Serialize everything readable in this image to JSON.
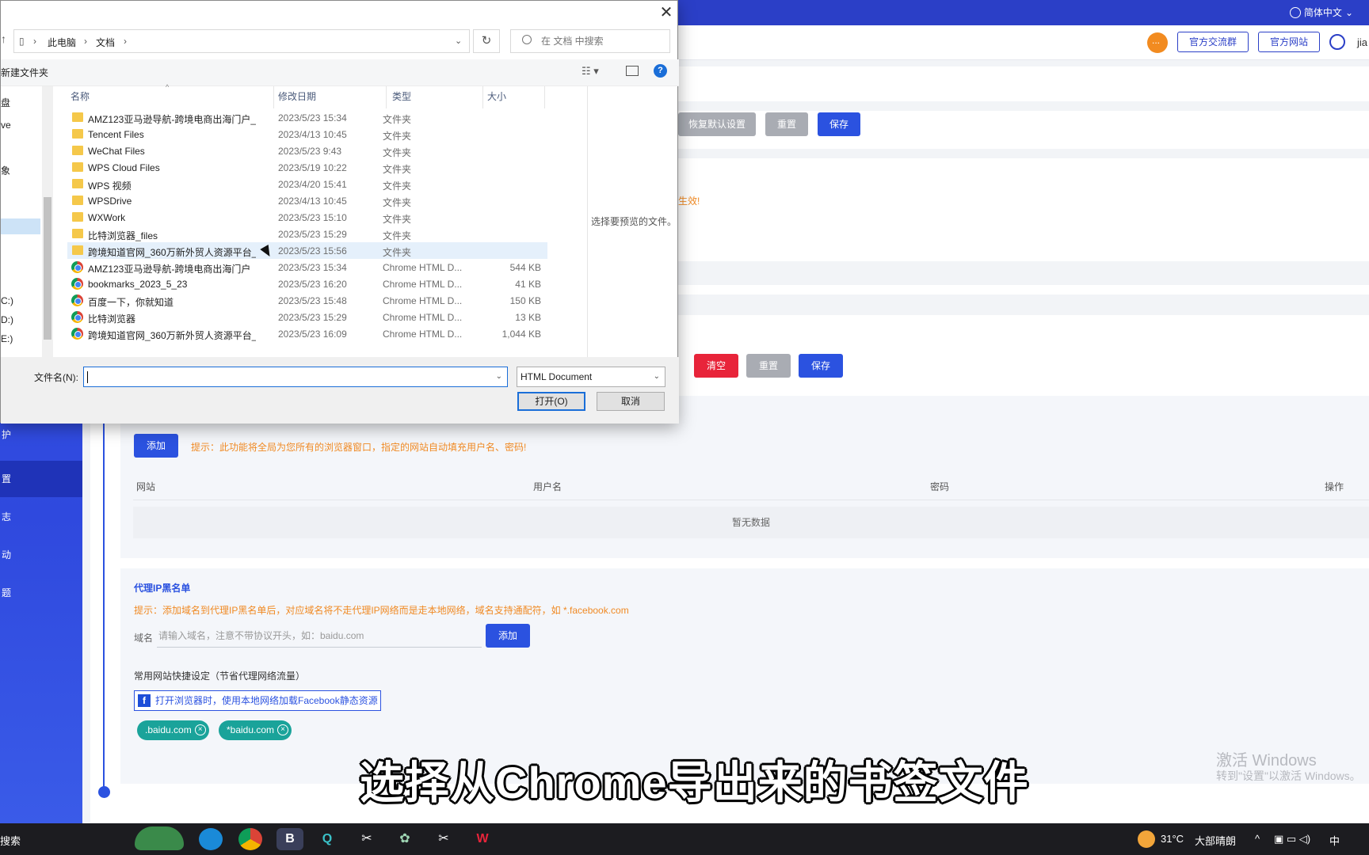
{
  "app": {
    "language": "简体中文",
    "header_buttons": [
      "官方交流群",
      "官方网站"
    ],
    "user": "jia"
  },
  "sidebar": {
    "items": [
      "置",
      "志",
      "动",
      "题",
      "护"
    ]
  },
  "toolbar1": {
    "restore": "恢复默认设置",
    "reset": "重置",
    "save": "保存"
  },
  "notice1": "生效!",
  "toolbar2": {
    "clear": "清空",
    "reset": "重置",
    "save": "保存"
  },
  "autofill": {
    "add": "添加",
    "tip": "提示：此功能将全局为您所有的浏览器窗口，指定的网站自动填充用户名、密码!",
    "columns": [
      "网站",
      "用户名",
      "密码",
      "操作"
    ],
    "empty": "暂无数据"
  },
  "blacklist": {
    "title": "代理IP黑名单",
    "tip": "提示：添加域名到代理IP黑名单后，对应域名将不走代理IP网络而是走本地网络，域名支持通配符，如 *.facebook.com",
    "domain_label": "域名",
    "domain_placeholder": "请输入域名，注意不带协议开头，如：baidu.com",
    "add": "添加",
    "shortcut_title": "常用网站快捷设定（节省代理网络流量）",
    "facebook_option": "打开浏览器时，使用本地网络加载Facebook静态资源",
    "tags": [
      ".baidu.com",
      "*baidu.com"
    ]
  },
  "watermark": {
    "line1": "激活 Windows",
    "line2": "转到\"设置\"以激活 Windows。"
  },
  "subtitle": "选择从Chrome导出来的书签文件",
  "dialog": {
    "breadcrumb": [
      "此电脑",
      "文档"
    ],
    "search_placeholder": "在 文档 中搜索",
    "new_folder": "新建文件夹",
    "nav_items": [
      "盘",
      "ve",
      "象",
      "C:)",
      "D:)",
      "E:)"
    ],
    "columns": {
      "name": "名称",
      "date": "修改日期",
      "type": "类型",
      "size": "大小"
    },
    "files": [
      {
        "name": "AMZ123亚马逊导航-跨境电商出海门户_...",
        "date": "2023/5/23 15:34",
        "type": "文件夹",
        "size": "",
        "icon": "folder"
      },
      {
        "name": "Tencent Files",
        "date": "2023/4/13 10:45",
        "type": "文件夹",
        "size": "",
        "icon": "folder"
      },
      {
        "name": "WeChat Files",
        "date": "2023/5/23 9:43",
        "type": "文件夹",
        "size": "",
        "icon": "folder"
      },
      {
        "name": "WPS Cloud Files",
        "date": "2023/5/19 10:22",
        "type": "文件夹",
        "size": "",
        "icon": "folder"
      },
      {
        "name": "WPS 视频",
        "date": "2023/4/20 15:41",
        "type": "文件夹",
        "size": "",
        "icon": "folder"
      },
      {
        "name": "WPSDrive",
        "date": "2023/4/13 10:45",
        "type": "文件夹",
        "size": "",
        "icon": "folder"
      },
      {
        "name": "WXWork",
        "date": "2023/5/23 15:10",
        "type": "文件夹",
        "size": "",
        "icon": "folder"
      },
      {
        "name": "比特浏览器_files",
        "date": "2023/5/23 15:29",
        "type": "文件夹",
        "size": "",
        "icon": "folder"
      },
      {
        "name": "跨境知道官网_360万新外贸人资源平台_...",
        "date": "2023/5/23 15:56",
        "type": "文件夹",
        "size": "",
        "icon": "folder"
      },
      {
        "name": "AMZ123亚马逊导航-跨境电商出海门户",
        "date": "2023/5/23 15:34",
        "type": "Chrome HTML D...",
        "size": "544 KB",
        "icon": "chrome"
      },
      {
        "name": "bookmarks_2023_5_23",
        "date": "2023/5/23 16:20",
        "type": "Chrome HTML D...",
        "size": "41 KB",
        "icon": "chrome"
      },
      {
        "name": "百度一下，你就知道",
        "date": "2023/5/23 15:48",
        "type": "Chrome HTML D...",
        "size": "150 KB",
        "icon": "chrome"
      },
      {
        "name": "比特浏览器",
        "date": "2023/5/23 15:29",
        "type": "Chrome HTML D...",
        "size": "13 KB",
        "icon": "chrome"
      },
      {
        "name": "跨境知道官网_360万新外贸人资源平台_...",
        "date": "2023/5/23 16:09",
        "type": "Chrome HTML D...",
        "size": "1,044 KB",
        "icon": "chrome"
      }
    ],
    "preview_text": "选择要预览的文件。",
    "filename_label": "文件名(N):",
    "filename_value": "",
    "filetype": "HTML Document",
    "open": "打开(O)",
    "cancel": "取消"
  },
  "taskbar": {
    "search": "搜索",
    "apps": [
      "edge",
      "chrome",
      "bitbrowser",
      "search-app",
      "capcut",
      "fan",
      "capcut2",
      "wps"
    ],
    "temperature": "31°C",
    "weather": "大部晴朗",
    "ime": "中"
  }
}
